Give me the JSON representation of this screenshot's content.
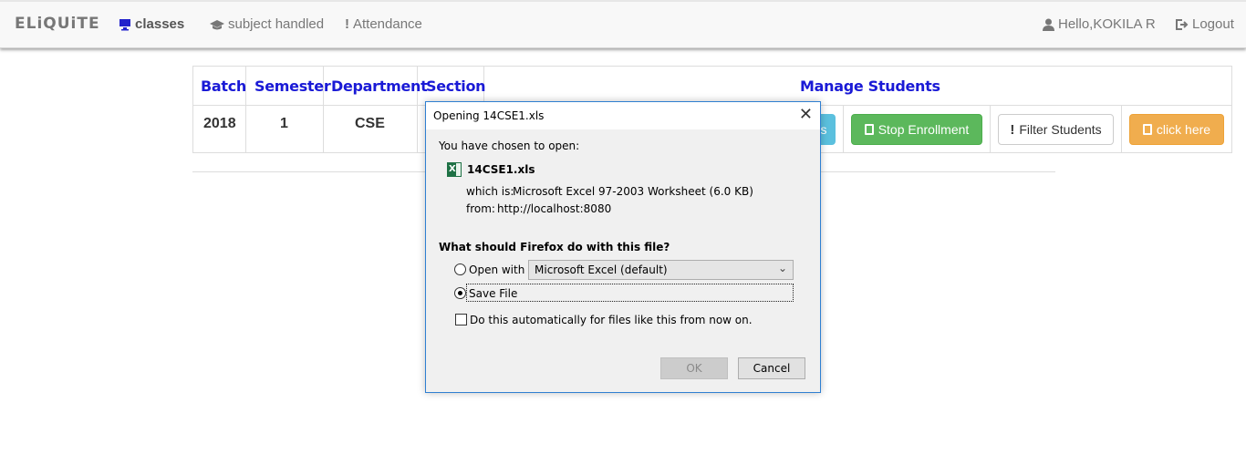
{
  "navbar": {
    "brand": "ELiQUiTE",
    "classes": "classes",
    "subject_handled": "subject handled",
    "attendance": "Attendance",
    "hello": "Hello,KOKILA R",
    "logout": "Logout"
  },
  "table": {
    "headers": [
      "Batch",
      "Semester",
      "Department",
      "Section",
      "Manage Students"
    ],
    "row": {
      "batch": "2018",
      "semester": "1",
      "department": "CSE"
    },
    "buttons": {
      "partial_info": "s",
      "stop_enrollment": "Stop Enrollment",
      "filter_students": "Filter Students",
      "click_here": "click here"
    }
  },
  "dialog": {
    "title": "Opening 14CSE1.xls",
    "intro": "You have chosen to open:",
    "filename": "14CSE1.xls",
    "which_is_label": "which is:",
    "which_is_value": "Microsoft Excel 97-2003 Worksheet (6.0 KB)",
    "from_label": "from:",
    "from_value": "http://localhost:8080",
    "question": "What should Firefox do with this file?",
    "open_with_label": "Open with",
    "open_with_value": "Microsoft Excel (default)",
    "save_file_label": "Save File",
    "auto_label": "Do this automatically for files like this from now on.",
    "ok": "OK",
    "cancel": "Cancel",
    "selected_option": "Save File"
  },
  "colors": {
    "header_blue": "#1a1ad6",
    "success": "#5cb85c",
    "warning": "#f0ad4e",
    "info": "#5bc0de",
    "dialog_border": "#2f7fd1"
  }
}
